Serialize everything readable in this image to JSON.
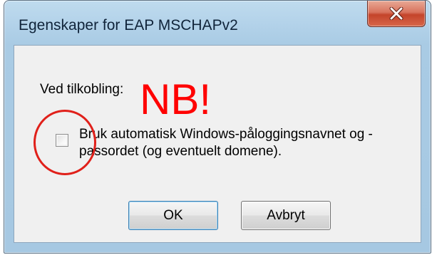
{
  "window": {
    "title": "Egenskaper for EAP MSCHAPv2",
    "close_icon": "close-icon",
    "close_color": "#c4442b"
  },
  "content": {
    "section_label": "Ved tilkobling:",
    "annotation_text": "NB!",
    "annotation_color": "#ff0000",
    "checkbox": {
      "label": "Bruk automatisk Windows-påloggingsnavnet og -passordet (og eventuelt domene).",
      "checked": false
    }
  },
  "buttons": {
    "ok_label": "OK",
    "cancel_label": "Avbryt"
  }
}
